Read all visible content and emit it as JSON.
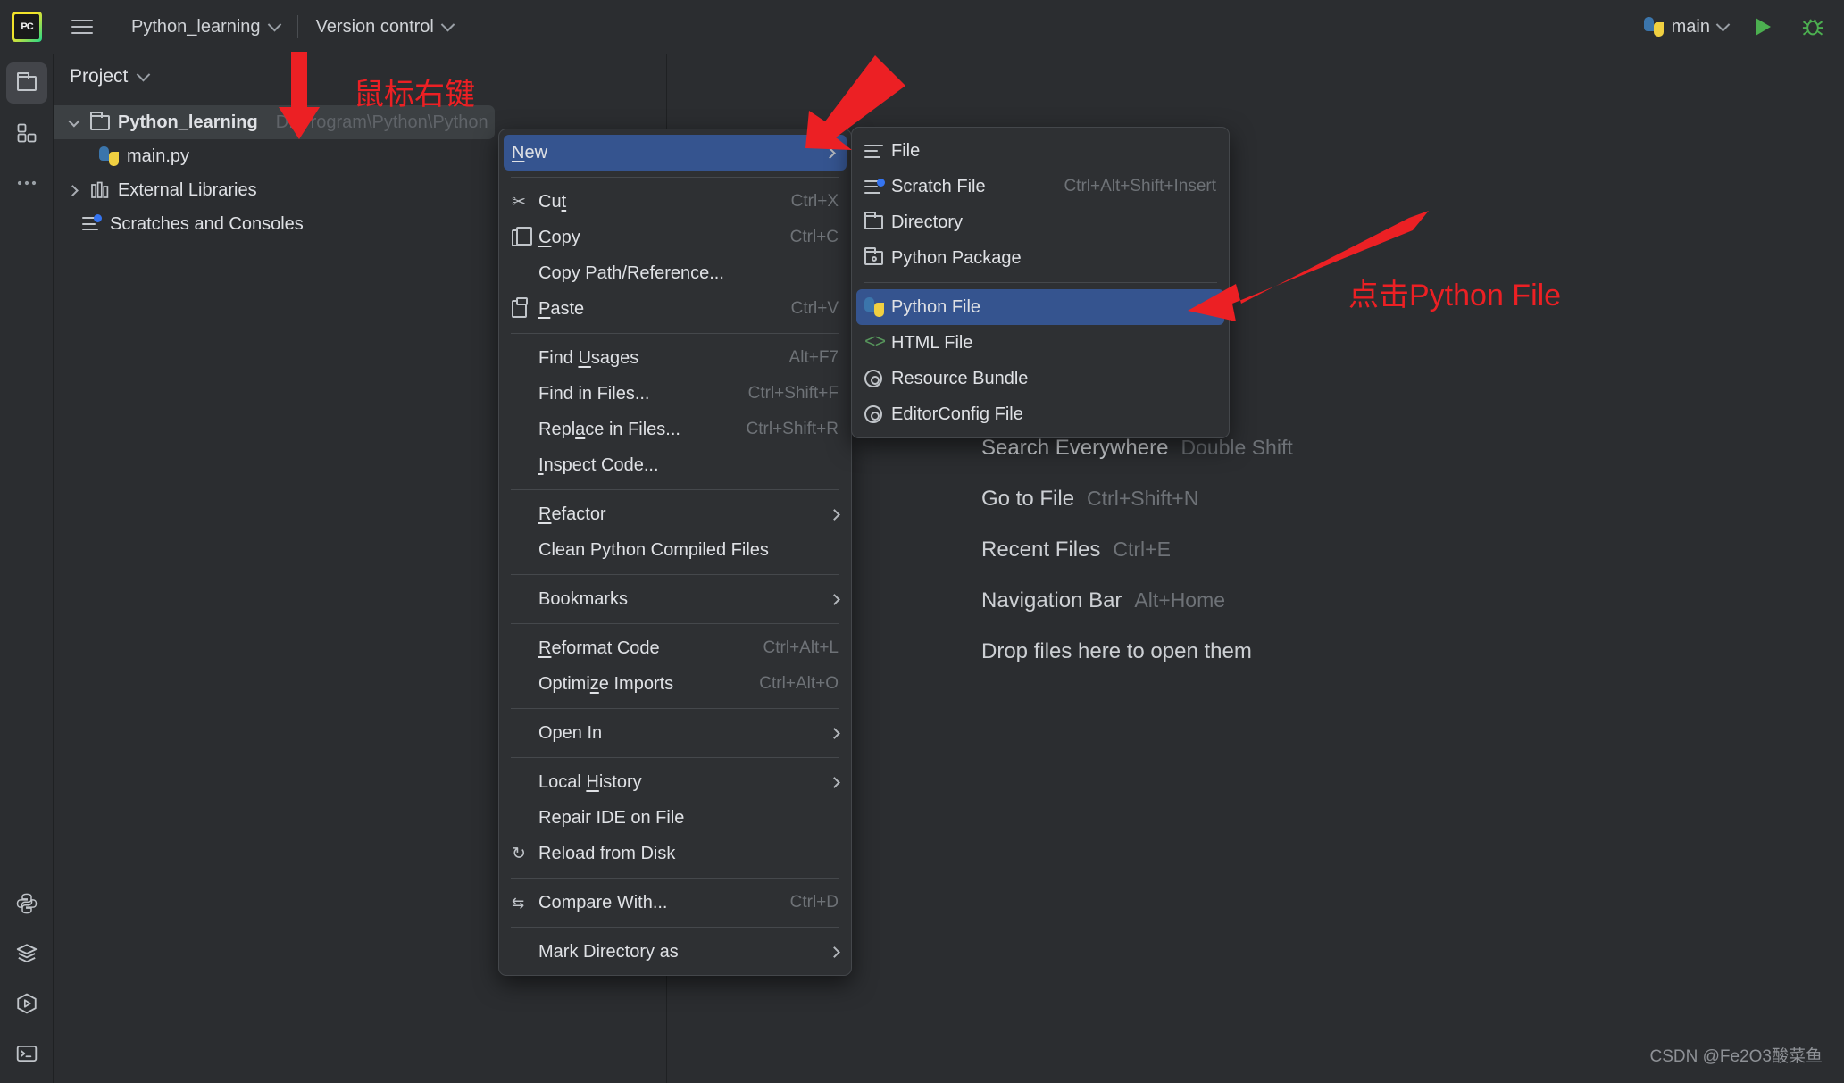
{
  "app": {
    "logo_text": "PC",
    "project_name": "Python_learning",
    "version_control": "Version control",
    "run_config": "main",
    "run_icon": "run-play-icon",
    "debug_icon": "debug-bug-icon",
    "menu_icon": "hamburger-menu-icon"
  },
  "rail": {
    "top": [
      {
        "name": "project-tool-window",
        "icon": "folder-icon",
        "active": true
      },
      {
        "name": "structure-tool-window",
        "icon": "structure-squares-icon",
        "active": false
      },
      {
        "name": "more-tool-windows",
        "icon": "ellipsis-icon",
        "active": false
      }
    ],
    "bottom": [
      {
        "name": "python-console",
        "icon": "python-icon"
      },
      {
        "name": "services",
        "icon": "layers-icon"
      },
      {
        "name": "run-tool-window",
        "icon": "hexagon-play-icon"
      },
      {
        "name": "terminal",
        "icon": "terminal-icon"
      }
    ]
  },
  "project_panel": {
    "title": "Project",
    "tree": [
      {
        "label": "Python_learning",
        "path": "D:\\Program\\Python\\Python",
        "icon": "folder-icon",
        "expanded": true,
        "selected": true,
        "bold": true,
        "indent": 0
      },
      {
        "label": "main.py",
        "path": "",
        "icon": "python-file-icon",
        "expanded": null,
        "selected": false,
        "bold": false,
        "indent": 1
      },
      {
        "label": "External Libraries",
        "path": "",
        "icon": "library-icon",
        "expanded": false,
        "selected": false,
        "bold": false,
        "indent": 0
      },
      {
        "label": "Scratches and Consoles",
        "path": "",
        "icon": "scratches-icon",
        "expanded": null,
        "selected": false,
        "bold": false,
        "indent": 0
      }
    ]
  },
  "editor": {
    "hints": [
      {
        "name": "Search Everywhere",
        "key": "Double Shift"
      },
      {
        "name": "Go to File",
        "key": "Ctrl+Shift+N"
      },
      {
        "name": "Recent Files",
        "key": "Ctrl+E"
      },
      {
        "name": "Navigation Bar",
        "key": "Alt+Home"
      },
      {
        "name": "Drop files here to open them",
        "key": ""
      }
    ]
  },
  "context_menu": {
    "items": [
      {
        "type": "item",
        "label": "New",
        "accel": "N",
        "key": "",
        "icon": "",
        "submenu": true,
        "highlighted": true
      },
      {
        "type": "sep"
      },
      {
        "type": "item",
        "label": "Cut",
        "accel": "t",
        "key": "Ctrl+X",
        "icon": "scissors-icon",
        "submenu": false,
        "highlighted": false
      },
      {
        "type": "item",
        "label": "Copy",
        "accel": "C",
        "key": "Ctrl+C",
        "icon": "copy-icon",
        "submenu": false,
        "highlighted": false
      },
      {
        "type": "item",
        "label": "Copy Path/Reference...",
        "accel": "",
        "key": "",
        "icon": "",
        "submenu": false,
        "highlighted": false
      },
      {
        "type": "item",
        "label": "Paste",
        "accel": "P",
        "key": "Ctrl+V",
        "icon": "paste-icon",
        "submenu": false,
        "highlighted": false
      },
      {
        "type": "sep"
      },
      {
        "type": "item",
        "label": "Find Usages",
        "accel": "U",
        "key": "Alt+F7",
        "icon": "",
        "submenu": false,
        "highlighted": false
      },
      {
        "type": "item",
        "label": "Find in Files...",
        "accel": "",
        "key": "Ctrl+Shift+F",
        "icon": "",
        "submenu": false,
        "highlighted": false
      },
      {
        "type": "item",
        "label": "Replace in Files...",
        "accel": "a",
        "key": "Ctrl+Shift+R",
        "icon": "",
        "submenu": false,
        "highlighted": false
      },
      {
        "type": "item",
        "label": "Inspect Code...",
        "accel": "I",
        "key": "",
        "icon": "",
        "submenu": false,
        "highlighted": false
      },
      {
        "type": "sep"
      },
      {
        "type": "item",
        "label": "Refactor",
        "accel": "R",
        "key": "",
        "icon": "",
        "submenu": true,
        "highlighted": false
      },
      {
        "type": "item",
        "label": "Clean Python Compiled Files",
        "accel": "",
        "key": "",
        "icon": "",
        "submenu": false,
        "highlighted": false
      },
      {
        "type": "sep"
      },
      {
        "type": "item",
        "label": "Bookmarks",
        "accel": "",
        "key": "",
        "icon": "",
        "submenu": true,
        "highlighted": false
      },
      {
        "type": "sep"
      },
      {
        "type": "item",
        "label": "Reformat Code",
        "accel": "R",
        "key": "Ctrl+Alt+L",
        "icon": "",
        "submenu": false,
        "highlighted": false
      },
      {
        "type": "item",
        "label": "Optimize Imports",
        "accel": "z",
        "key": "Ctrl+Alt+O",
        "icon": "",
        "submenu": false,
        "highlighted": false
      },
      {
        "type": "sep"
      },
      {
        "type": "item",
        "label": "Open In",
        "accel": "",
        "key": "",
        "icon": "",
        "submenu": true,
        "highlighted": false
      },
      {
        "type": "sep"
      },
      {
        "type": "item",
        "label": "Local History",
        "accel": "H",
        "key": "",
        "icon": "",
        "submenu": true,
        "highlighted": false
      },
      {
        "type": "item",
        "label": "Repair IDE on File",
        "accel": "",
        "key": "",
        "icon": "",
        "submenu": false,
        "highlighted": false
      },
      {
        "type": "item",
        "label": "Reload from Disk",
        "accel": "",
        "key": "",
        "icon": "reload-icon",
        "submenu": false,
        "highlighted": false
      },
      {
        "type": "sep"
      },
      {
        "type": "item",
        "label": "Compare With...",
        "accel": "",
        "key": "Ctrl+D",
        "icon": "compare-icon",
        "submenu": false,
        "highlighted": false
      },
      {
        "type": "sep"
      },
      {
        "type": "item",
        "label": "Mark Directory as",
        "accel": "",
        "key": "",
        "icon": "",
        "submenu": true,
        "highlighted": false
      }
    ]
  },
  "new_submenu": {
    "items": [
      {
        "type": "item",
        "label": "File",
        "key": "",
        "icon": "file-lines-icon",
        "highlighted": false
      },
      {
        "type": "item",
        "label": "Scratch File",
        "key": "Ctrl+Alt+Shift+Insert",
        "icon": "scratch-file-icon",
        "highlighted": false
      },
      {
        "type": "item",
        "label": "Directory",
        "key": "",
        "icon": "folder-icon",
        "highlighted": false
      },
      {
        "type": "item",
        "label": "Python Package",
        "key": "",
        "icon": "package-folder-icon",
        "highlighted": false
      },
      {
        "type": "sep"
      },
      {
        "type": "item",
        "label": "Python File",
        "key": "",
        "icon": "python-file-icon",
        "highlighted": true
      },
      {
        "type": "item",
        "label": "HTML File",
        "key": "",
        "icon": "html-icon",
        "highlighted": false
      },
      {
        "type": "item",
        "label": "Resource Bundle",
        "key": "",
        "icon": "gear-icon",
        "highlighted": false
      },
      {
        "type": "item",
        "label": "EditorConfig File",
        "key": "",
        "icon": "gear-icon",
        "highlighted": false
      }
    ]
  },
  "annotations": {
    "right_click": "鼠标右键",
    "click_python_file": "点击Python File",
    "color": "#ec2024"
  },
  "watermark": "CSDN @Fe2O3酸菜鱼"
}
